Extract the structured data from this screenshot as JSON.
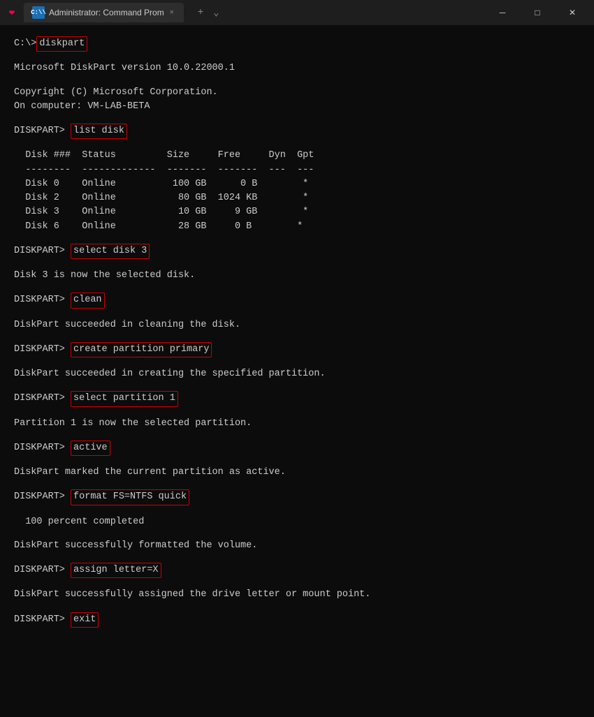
{
  "window": {
    "title": "Administrator: Command Prom",
    "tab_label": "Administrator: Command Prom"
  },
  "titlebar": {
    "add_tab": "+",
    "dropdown": "⌄",
    "minimize": "─",
    "maximize": "□",
    "close": "✕"
  },
  "terminal": {
    "initial_cmd_label": "diskpart",
    "line1": "C:\\>",
    "line2": "",
    "line3": "Microsoft DiskPart version 10.0.22000.1",
    "line4": "",
    "line5": "Copyright (C) Microsoft Corporation.",
    "line6": "On computer: VM-LAB-BETA",
    "line7": "",
    "prompt_list_disk": "DISKPART> ",
    "cmd_list_disk": "list disk",
    "line_after_list_disk": "",
    "table_header": "  Disk ###  Status         Size     Free     Dyn  Gpt",
    "table_sep": "  --------  -------------  -------  -------  ---  ---",
    "disk0": "  Disk 0    Online          100 GB      0 B        *",
    "disk2": "  Disk 2    Online           80 GB  1024 KB        *",
    "disk3": "  Disk 3    Online           10 GB     9 GB        *",
    "disk6": "  Disk 6    Online           28 GB     0 B        *",
    "blank1": "",
    "prompt_select_disk": "DISKPART> ",
    "cmd_select_disk": "select disk 3",
    "resp_select_disk": "Disk 3 is now the selected disk.",
    "blank2": "",
    "prompt_clean": "DISKPART> ",
    "cmd_clean": "clean",
    "resp_clean": "DiskPart succeeded in cleaning the disk.",
    "blank3": "",
    "prompt_create": "DISKPART> ",
    "cmd_create": "create partition primary",
    "resp_create": "DiskPart succeeded in creating the specified partition.",
    "blank4": "",
    "prompt_sel_part": "DISKPART> ",
    "cmd_sel_part": "select partition 1",
    "resp_sel_part": "Partition 1 is now the selected partition.",
    "blank5": "",
    "prompt_active": "DISKPART> ",
    "cmd_active": "active",
    "resp_active": "DiskPart marked the current partition as active.",
    "blank6": "",
    "prompt_format": "DISKPART> ",
    "cmd_format": "format FS=NTFS quick",
    "resp_format1": "  100 percent completed",
    "blank7": "",
    "resp_format2": "DiskPart successfully formatted the volume.",
    "blank8": "",
    "prompt_assign": "DISKPART> ",
    "cmd_assign": "assign letter=X",
    "resp_assign": "DiskPart successfully assigned the drive letter or mount point.",
    "blank9": "",
    "prompt_exit": "DISKPART> ",
    "cmd_exit": "exit"
  }
}
